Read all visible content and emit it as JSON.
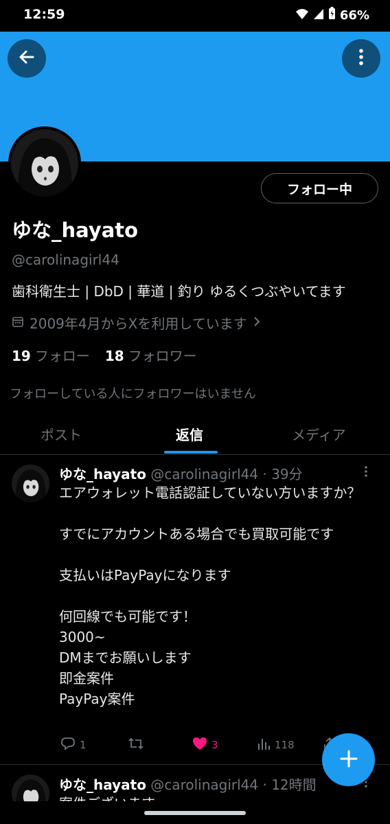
{
  "status_bar": {
    "time": "12:59",
    "battery": "66%"
  },
  "header": {
    "back_icon": "arrow-left-icon",
    "more_icon": "more-vertical-icon",
    "banner_color": "#1d9bf0"
  },
  "profile": {
    "follow_button": "フォロー中",
    "display_name": "ゆな_hayato",
    "handle": "@carolinagirl44",
    "bio": "歯科衛生士 | DbD | 華道 | 釣り ゆるくつぶやいてます",
    "joined": "2009年4月からXを利用しています",
    "following_count": "19",
    "following_label": "フォロー",
    "followers_count": "18",
    "followers_label": "フォロワー",
    "mutual_note": "フォローしている人にフォロワーはいません"
  },
  "tabs": [
    {
      "label": "ポスト",
      "active": false
    },
    {
      "label": "返信",
      "active": true
    },
    {
      "label": "メディア",
      "active": false
    }
  ],
  "posts": [
    {
      "name": "ゆな_hayato",
      "handle": "@carolinagirl44",
      "time": "39分",
      "text": "エアウォレット電話認証していない方いますか？\n\nすでにアカウントある場合でも買取可能です\n\n支払いはPayPayになります\n\n何回線でも可能です！\n3000~\nDMまでお願いします\n即金案件\nPayPay案件",
      "replies": "1",
      "likes": "3",
      "views": "118"
    },
    {
      "name": "ゆな_hayato",
      "handle": "@carolinagirl44",
      "time": "12時間",
      "text": "案件ございます"
    }
  ],
  "fab": {
    "icon": "plus-icon"
  },
  "colors": {
    "accent": "#1d9bf0",
    "like": "#f91880",
    "muted": "#71767b"
  }
}
